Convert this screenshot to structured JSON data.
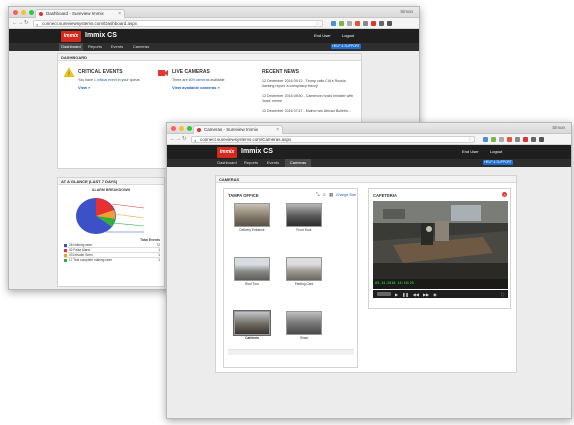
{
  "window1": {
    "tab_title": "Dashboard - Sureview Immix",
    "os_user": "Simon",
    "url": "connect.sureviewsystems.com/Dashboard.aspx",
    "app": {
      "logo_text": "immix",
      "title": "Immix CS",
      "user_menu": "End User",
      "logout": "Logout",
      "help_button": "HELP & SUPPORT",
      "nav": [
        "Dashboard",
        "Reports",
        "Events",
        "Cameras"
      ]
    },
    "dashboard": {
      "title": "DASHBOARD",
      "critical": {
        "heading": "CRITICAL EVENTS",
        "text_prefix": "You have ",
        "count_link": "1 critical event",
        "text_suffix": " in your queue.",
        "view_link": "View »"
      },
      "live": {
        "heading": "LIVE CAMERAS",
        "text_prefix": "There are ",
        "count_link": "609 cameras",
        "text_suffix": " available",
        "view_link": "View available cameras »"
      },
      "news": {
        "heading": "RECENT NEWS",
        "items": [
          "12 December 2016 09:12 - Trump calls CIA's Russia hacking report 'a conspiracy theory'",
          "12 December 2016 08:50 - Cameroon hosts minister with 'boss' meme",
          "12 December 2016 07:47 - Malmo win African Bulletin..."
        ]
      }
    },
    "glance": {
      "title": "AT A GLANCE (LAST 7 DAYS)",
      "chart_title": "ALARM BREAKDOWN",
      "table_header": "Total Events",
      "rows": [
        {
          "label": "26 Nothing seen",
          "value": "72",
          "color": "#3c50c8"
        },
        {
          "label": "02 False Alarm",
          "value": "1",
          "color": "#e83030"
        },
        {
          "label": "03 Intruder Seen",
          "value": "1",
          "color": "#f0a030"
        },
        {
          "label": "17 Test complete nothing seen",
          "value": "1",
          "color": "#30b040"
        }
      ]
    }
  },
  "window2": {
    "tab_title": "Cameras - Sureview Immix",
    "os_user": "Simon",
    "url": "connect.sureviewsystems.com/Cameras.aspx",
    "app": {
      "logo_text": "immix",
      "title": "Immix CS",
      "user_menu": "End User",
      "logout": "Logout",
      "help_button": "HELP & SUPPORT",
      "nav": [
        "Dashboard",
        "Reports",
        "Events",
        "Cameras"
      ]
    },
    "cameras": {
      "title": "CAMERAS",
      "site": "TAMPA OFFICE",
      "change_size": "Change Size",
      "thumbnails": [
        "Delivery Entrance",
        "Front Door",
        "Roof Tour",
        "Parking Card",
        "Cafeteria",
        "Shaw"
      ],
      "viewer_title": "CAFETERIA",
      "timestamp": "03-14-2016 14:10:25"
    }
  }
}
